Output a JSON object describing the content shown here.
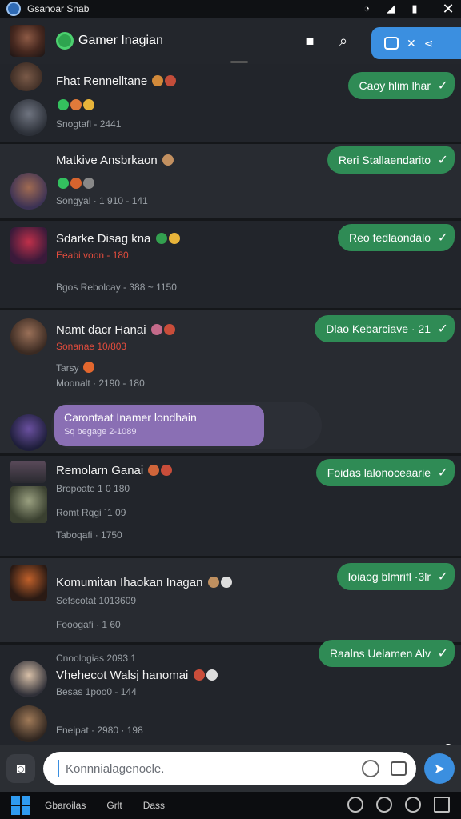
{
  "statusbar": {
    "title": "Gsanoar Snab"
  },
  "header": {
    "title": "Gamer Inagian"
  },
  "chats": [
    {
      "name": "Fhat Rennelltane",
      "status": "Snogtafl - 2441",
      "reply": "Caoy hlim lhar"
    },
    {
      "name": "Matkive Ansbrkaon",
      "status": "Songyal · 1 910 - 141",
      "reply": "Reri Stallaendarito"
    },
    {
      "name": "Sdarke Disag kna",
      "sub1": "Eeabi voon - 180",
      "status": "Bgos   Rebolcay - 388 ~ 1150",
      "reply": "Reo fedlaondalo"
    },
    {
      "name": "Namt dacr Hanai",
      "sub1": "Sonanae 10/803",
      "sub2": "Tarsy",
      "status": "Moonalt · 2190 - 180",
      "reply": "Dlao Kebarciave · 21"
    },
    {
      "highlight_text": "Carontaat Inamer londhain",
      "highlight_time": "Sq begage 2-1089"
    },
    {
      "name": "Remolarn Ganai",
      "sub1": "Bropoate 1 0 180",
      "sub2": "Romt Rqgi  ´1 09",
      "status": "Taboqafi · 1750",
      "reply": "Foidas lalonoceaarie"
    },
    {
      "name": "Komumitan Ihaokan Inagan",
      "sub1": "Sefscotat  1013609",
      "status": "Fooogafi · 1 60",
      "reply": "Ioiaog blmrifl ·3lr"
    },
    {
      "name": "Vhehecot Walsj hanomai",
      "sub0": "Cnoologias  2093 1",
      "sub1": "Besas 1poo0 - 144",
      "status": "Eneipat · 2980 · 198",
      "reply": "Raalns Uelamen  Alv"
    }
  ],
  "composer": {
    "placeholder": "Konnnialagenocle."
  },
  "taskbar": {
    "item1": "Gbaroilas",
    "item2": "Grlt",
    "item3": "Dass"
  },
  "colors": {
    "bubble": "#2f8b55",
    "accent": "#3b8fe0",
    "highlight": "#8a6fb4"
  }
}
